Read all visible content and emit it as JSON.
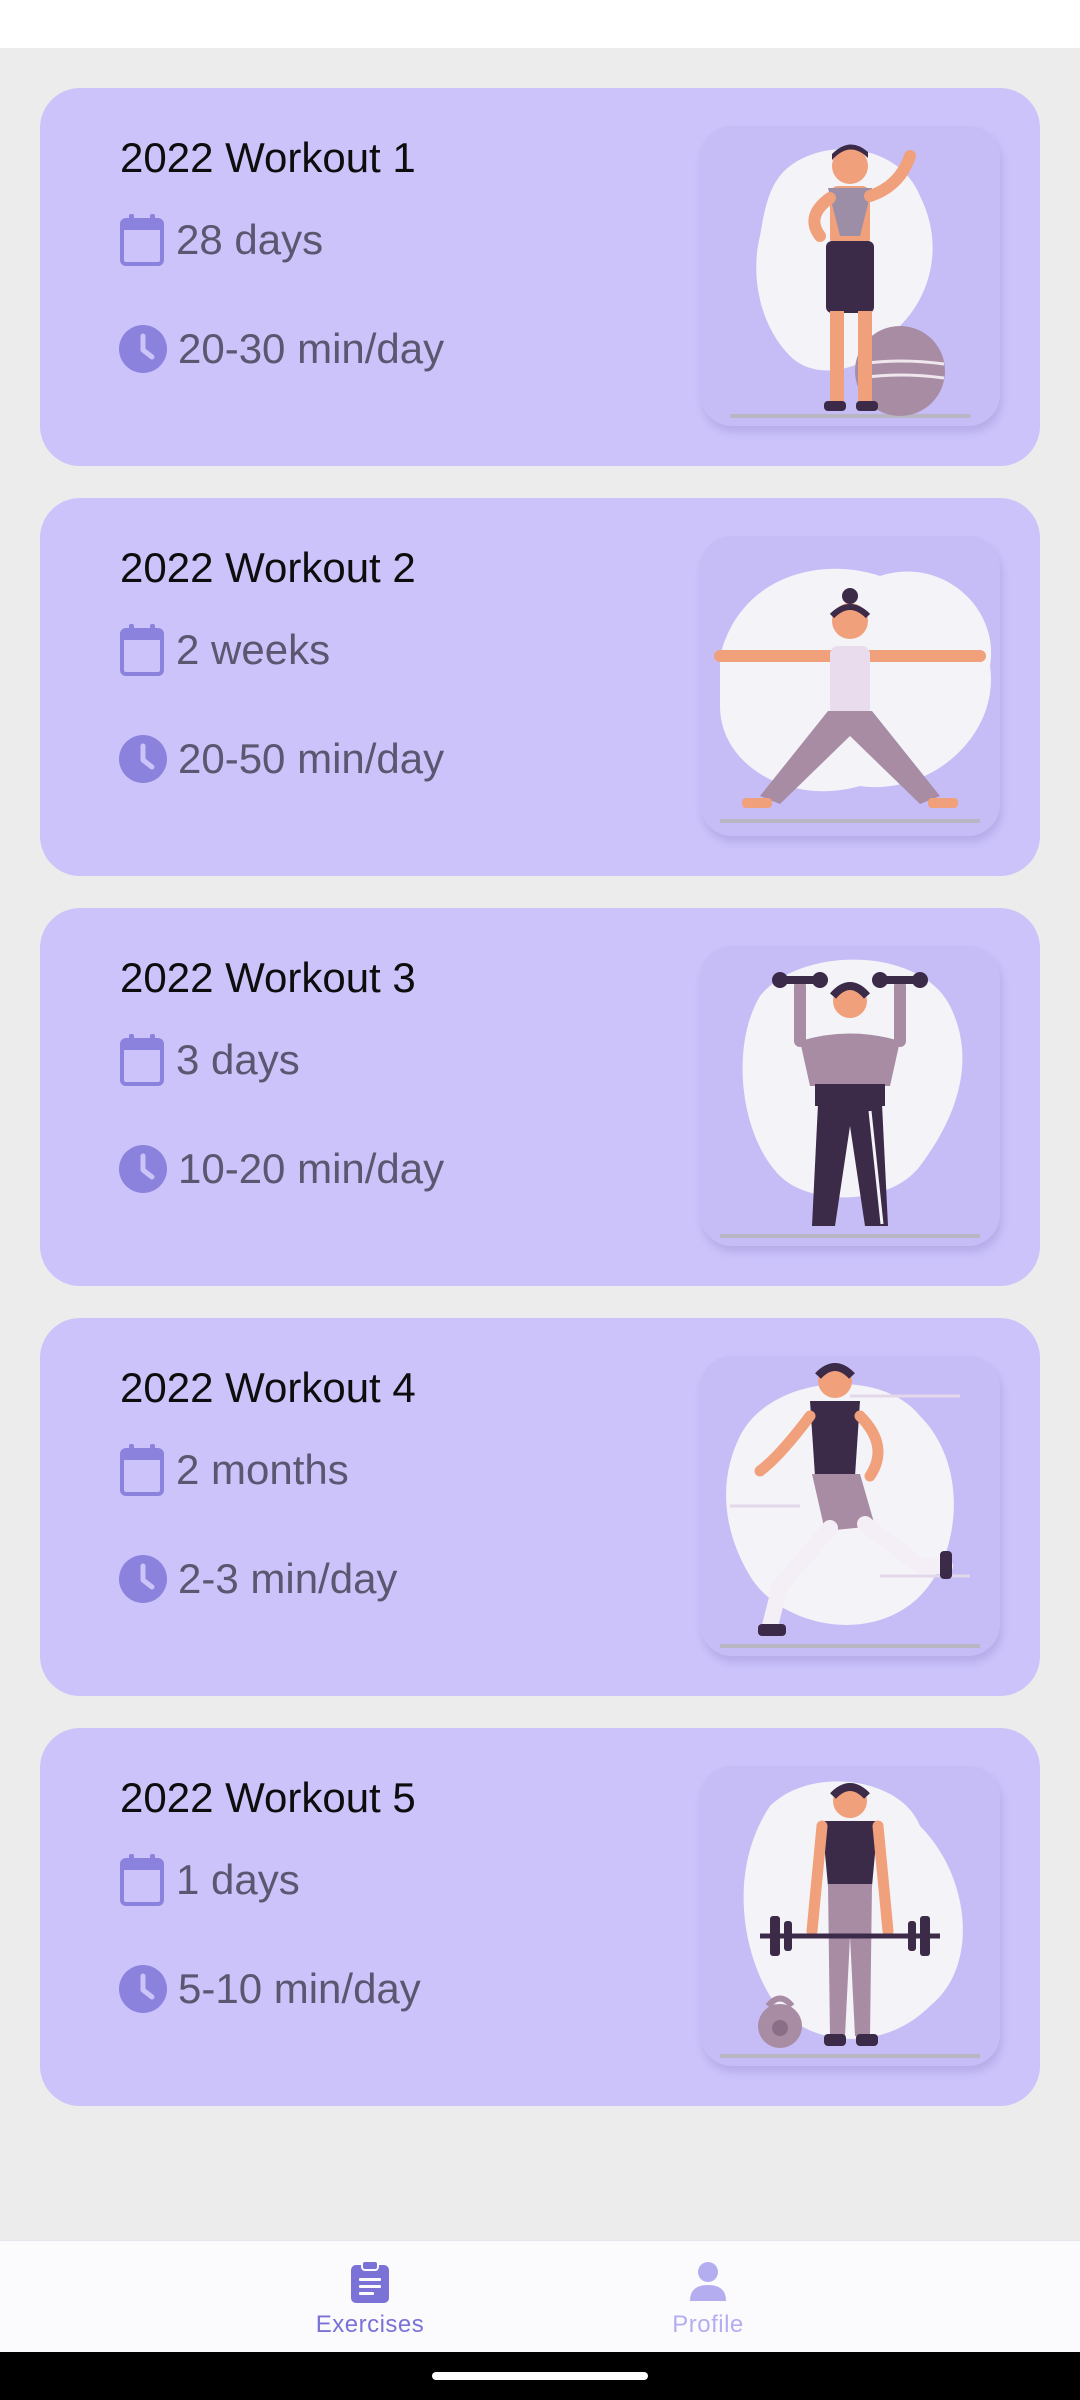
{
  "workouts": [
    {
      "title": "2022 Workout 1",
      "duration": "28 days",
      "time": "20-30 min/day",
      "illustration": "standing-towel-ball"
    },
    {
      "title": "2022 Workout 2",
      "duration": "2 weeks",
      "time": "20-50 min/day",
      "illustration": "warrior-pose"
    },
    {
      "title": "2022 Workout 3",
      "duration": "3 days",
      "time": "10-20 min/day",
      "illustration": "dumbbell-press"
    },
    {
      "title": "2022 Workout 4",
      "duration": "2 months",
      "time": "2-3 min/day",
      "illustration": "lunge-runner"
    },
    {
      "title": "2022 Workout 5",
      "duration": "1 days",
      "time": "5-10 min/day",
      "illustration": "barbell-kettlebell"
    }
  ],
  "icons": {
    "duration": "calendar-icon",
    "time": "clock-icon",
    "exercises": "clipboard-icon",
    "profile": "person-icon"
  },
  "nav": {
    "items": [
      {
        "label": "Exercises",
        "active": true
      },
      {
        "label": "Profile",
        "active": false
      }
    ]
  },
  "colors": {
    "card": "#cbc3fa",
    "icon": "#8a82dc",
    "active": "#7a72d6",
    "inactive": "#b4aef0",
    "background": "#ececec"
  }
}
